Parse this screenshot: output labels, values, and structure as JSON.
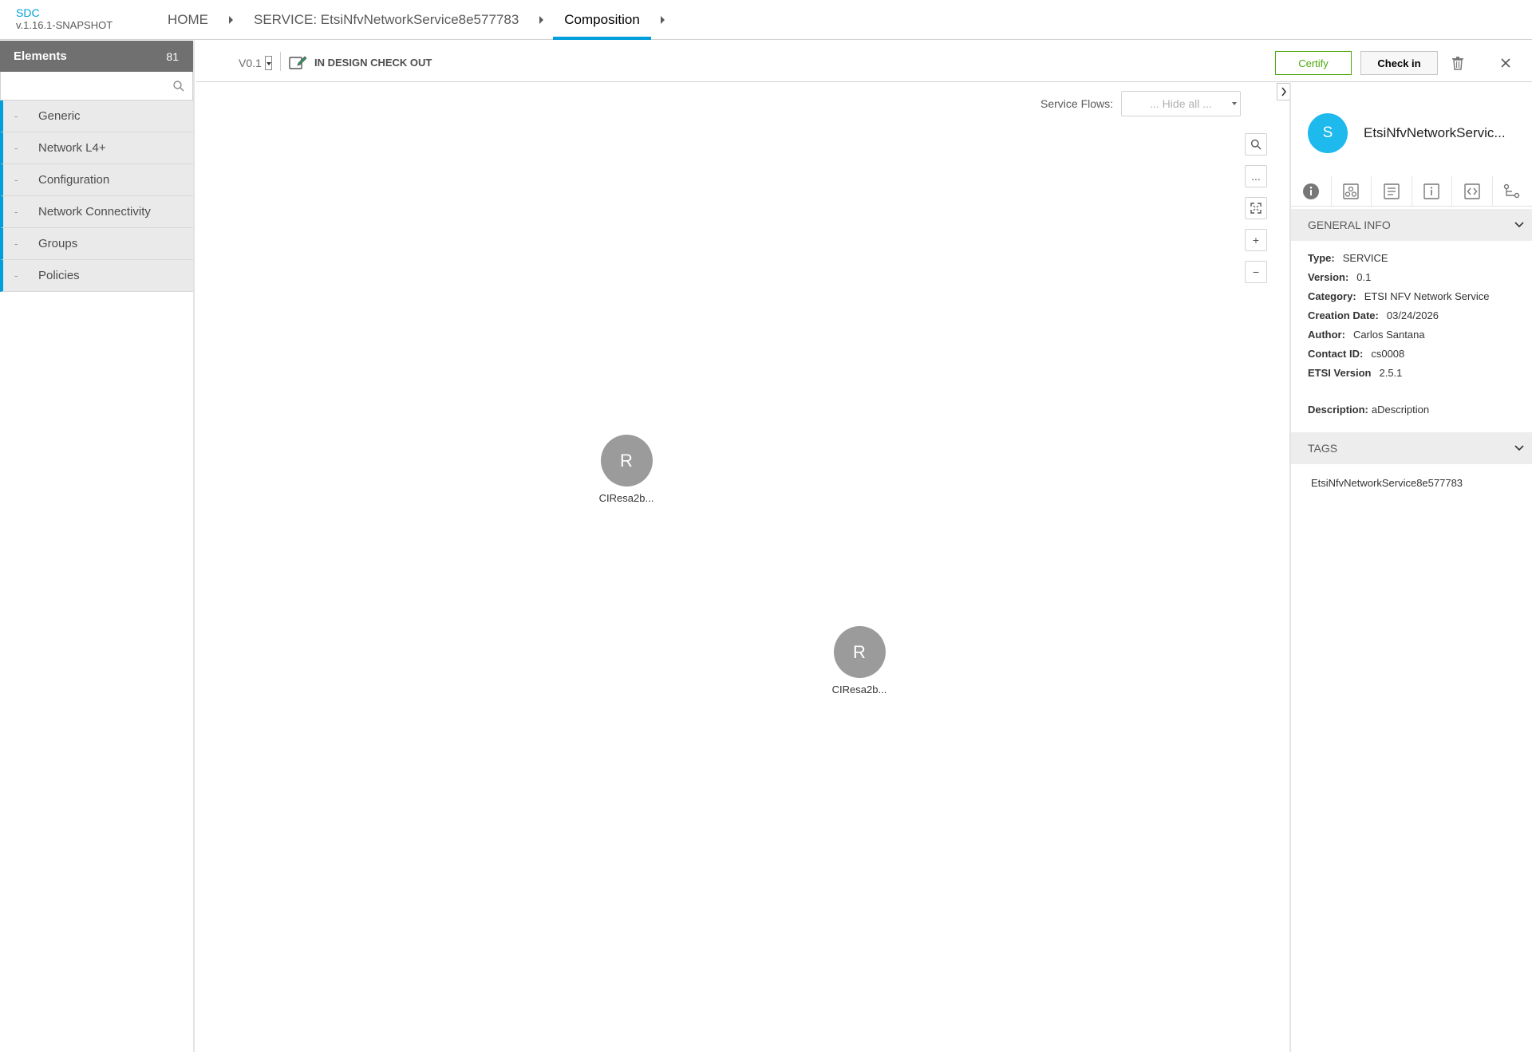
{
  "app": {
    "name": "SDC",
    "version": "v.1.16.1-SNAPSHOT"
  },
  "breadcrumb": {
    "home": "HOME",
    "service": "SERVICE: EtsiNfvNetworkService8e577783",
    "current": "Composition"
  },
  "palette": {
    "title": "Elements",
    "count": "81",
    "search": {
      "value": "",
      "placeholder": ""
    },
    "categories": [
      {
        "dash": "-",
        "label": "Generic"
      },
      {
        "dash": "-",
        "label": "Network L4+"
      },
      {
        "dash": "-",
        "label": "Configuration"
      },
      {
        "dash": "-",
        "label": "Network Connectivity"
      },
      {
        "dash": "-",
        "label": "Groups"
      },
      {
        "dash": "-",
        "label": "Policies"
      }
    ]
  },
  "toolbar": {
    "version": "V0.1",
    "status": "IN DESIGN CHECK OUT",
    "certify_label": "Certify",
    "checkin_label": "Check in"
  },
  "canvas": {
    "service_flows_label": "Service Flows:",
    "service_flows_value": "... Hide all ...",
    "controls": {
      "more": "...",
      "zoom_in": "+",
      "zoom_out": "−"
    },
    "nodes": [
      {
        "letter": "R",
        "label": "CIResa2b..."
      },
      {
        "letter": "R",
        "label": "CIResa2b..."
      }
    ]
  },
  "right_panel": {
    "avatar_letter": "S",
    "title": "EtsiNfvNetworkServic...",
    "general_info_title": "GENERAL INFO",
    "fields": [
      {
        "label": "Type:",
        "value": "SERVICE"
      },
      {
        "label": "Version:",
        "value": "0.1"
      },
      {
        "label": "Category:",
        "value": "ETSI NFV Network Service"
      },
      {
        "label": "Creation Date:",
        "value": "03/24/2026"
      },
      {
        "label": "Author:",
        "value": "Carlos Santana"
      },
      {
        "label": "Contact ID:",
        "value": "cs0008"
      },
      {
        "label": "ETSI Version",
        "value": "2.5.1"
      }
    ],
    "description_label": "Description:",
    "description_value": "aDescription",
    "tags_title": "TAGS",
    "tags": [
      "EtsiNfvNetworkService8e577783"
    ]
  },
  "colors": {
    "accent": "#009fdb",
    "certify": "#4ca90c",
    "node": "#9b9b9b",
    "avatar": "#1eb9ed"
  }
}
